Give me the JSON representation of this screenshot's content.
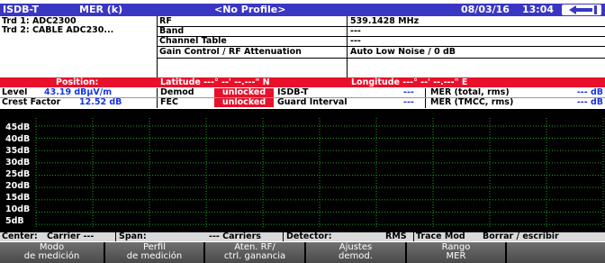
{
  "title_bar": {
    "mode": "ISDB-T",
    "measure": "MER (k)",
    "profile": "<No Profile>",
    "date": "08/03/16",
    "time": "13:04",
    "arrow_icon": "back-arrow-icon"
  },
  "info": {
    "trd1": "Trd 1: ADC2300",
    "trd2": "Trd 2: CABLE ADC230...",
    "params": [
      {
        "label": "RF",
        "value": "539.1428 MHz"
      },
      {
        "label": "Band",
        "value": "---"
      },
      {
        "label": "Channel Table",
        "value": "---"
      },
      {
        "label": "Gain Control / RF Attenuation",
        "value": "Auto Low Noise / 0 dB"
      }
    ]
  },
  "position_row": {
    "label": "Position:",
    "latitude": "Latitude ---° --' --.---\" N",
    "longitude": "Longitude ---° --' --.---\" E"
  },
  "measures": {
    "level_label": "Level",
    "level_value": "43.19 dBµV/m",
    "crest_label": "Crest Factor",
    "crest_value": "12.52 dB",
    "demod_label": "Demod",
    "demod_status": "unlocked",
    "fec_label": "FEC",
    "fec_status": "unlocked",
    "isdb_label": "ISDB-T",
    "isdb_value": "---",
    "guard_label": "Guard Interval",
    "guard_value": "---",
    "mer_total_label": "MER (total, rms)",
    "mer_total_value": "--- dB",
    "mer_tmcc_label": "MER (TMCC, rms)",
    "mer_tmcc_value": "--- dB"
  },
  "graph": {
    "y_labels": [
      "45dB",
      "40dB",
      "35dB",
      "30dB",
      "25dB",
      "20dB",
      "15dB",
      "10dB",
      "5dB"
    ]
  },
  "status": {
    "center": "Center:",
    "carrier": "Carrier ---",
    "span": "Span:",
    "carriers": "--- Carriers",
    "detector": "Detector:",
    "detector_value": "RMS",
    "trace": "Trace Mod",
    "borrar": "Borrar / escribir"
  },
  "softkeys": [
    {
      "line1": "Modo",
      "line2": "de medición"
    },
    {
      "line1": "Perfil",
      "line2": "de medición"
    },
    {
      "line1": "Aten. RF/",
      "line2": "ctrl. ganancia"
    },
    {
      "line1": "Ajustes",
      "line2": "demod."
    },
    {
      "line1": "Rango",
      "line2": "MER"
    },
    {
      "line1": "",
      "line2": ""
    }
  ]
}
